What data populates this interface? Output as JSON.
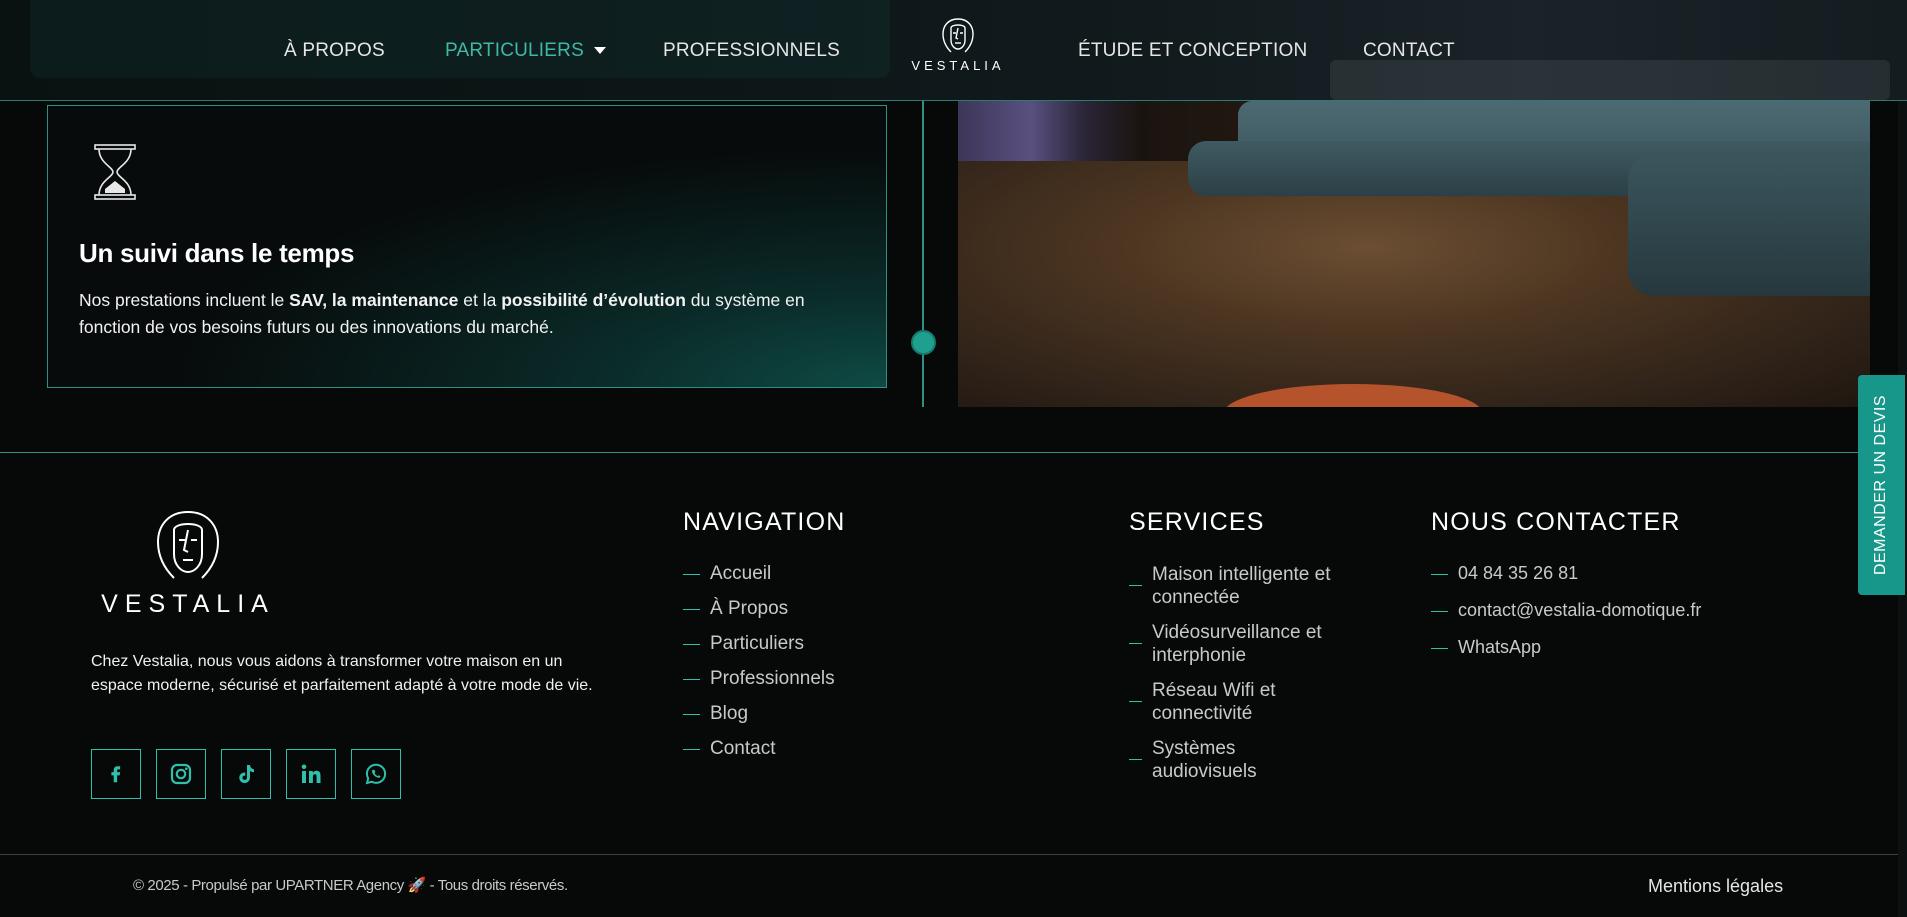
{
  "header": {
    "nav": [
      {
        "label": "À PROPOS"
      },
      {
        "label": "PARTICULIERS"
      },
      {
        "label": "PROFESSIONNELS"
      },
      {
        "label": "ÉTUDE ET CONCEPTION"
      },
      {
        "label": "CONTACT"
      }
    ],
    "logo_text": "VESTALIA",
    "active_color": "#3fb9a6"
  },
  "card": {
    "icon": "hourglass-icon",
    "title": "Un suivi dans le temps",
    "text_1": "Nos prestations incluent le ",
    "bold_1": "SAV, la maintenance",
    "text_2": " et la ",
    "bold_2": "possibilité d’évolution",
    "text_3": " du système en fonction de vos besoins futurs ou des innovations du marché."
  },
  "side_cta": "DEMANDER UN DEVIS",
  "footer": {
    "logo_text": "VESTALIA",
    "about": "Chez Vestalia, nous vous aidons à transformer votre maison en un espace moderne, sécurisé et parfaitement adapté à votre mode de vie.",
    "socials": [
      "facebook-icon",
      "instagram-icon",
      "tiktok-icon",
      "linkedin-icon",
      "whatsapp-icon"
    ],
    "navigation": {
      "title": "NAVIGATION",
      "items": [
        "Accueil",
        "À Propos",
        "Particuliers",
        "Professionnels",
        "Blog",
        "Contact"
      ]
    },
    "services": {
      "title": "SERVICES",
      "items": [
        {
          "line1": "Maison intelligente et",
          "line2": "connectée"
        },
        {
          "line1": "Vidéosurveillance et",
          "line2": "interphonie"
        },
        {
          "line1": "Réseau Wifi et",
          "line2": "connectivité"
        },
        {
          "line1": "Systèmes",
          "line2": "audiovisuels"
        }
      ]
    },
    "contact": {
      "title": "NOUS CONTACTER",
      "items": [
        "04 84 35 26 81",
        "contact@vestalia-domotique.fr",
        "WhatsApp"
      ]
    },
    "copyright": "© 2025 - Propulsé par  UPARTNER Agency 🚀  - Tous droits réservés.",
    "legal": "Mentions légales"
  },
  "colors": {
    "accent": "#2fbfaa",
    "cta": "#17968a",
    "background": "#070808"
  }
}
